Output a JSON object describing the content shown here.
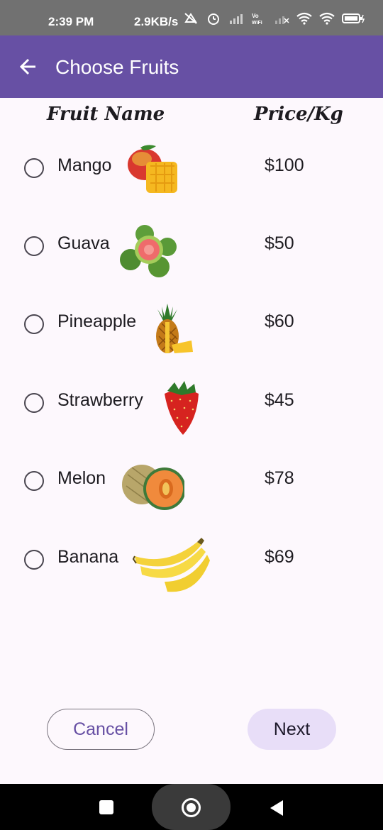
{
  "status_bar": {
    "time": "2:39 PM",
    "net_speed": "2.9KB/s",
    "icons": [
      "sim-icon",
      "mute-icon",
      "alarm-icon",
      "signal-icon",
      "vowifi-icon",
      "signal-off-icon",
      "wifi-icon",
      "hotspot-icon",
      "battery-icon"
    ]
  },
  "app_bar": {
    "title": "Choose Fruits",
    "background": "#6750a4"
  },
  "table": {
    "headers": {
      "name": "Fruit Name",
      "price": "Price/Kg"
    },
    "rows": [
      {
        "name": "Mango",
        "price": "$100",
        "image": "mango-image"
      },
      {
        "name": "Guava",
        "price": "$50",
        "image": "guava-image"
      },
      {
        "name": "Pineapple",
        "price": "$60",
        "image": "pineapple-image"
      },
      {
        "name": "Strawberry",
        "price": "$45",
        "image": "strawberry-image"
      },
      {
        "name": "Melon",
        "price": "$78",
        "image": "melon-image"
      },
      {
        "name": "Banana",
        "price": "$69",
        "image": "banana-image"
      }
    ]
  },
  "actions": {
    "cancel_label": "Cancel",
    "next_label": "Next"
  },
  "nav_bar": {
    "icons": [
      "recents-icon",
      "home-icon",
      "back-icon"
    ]
  }
}
